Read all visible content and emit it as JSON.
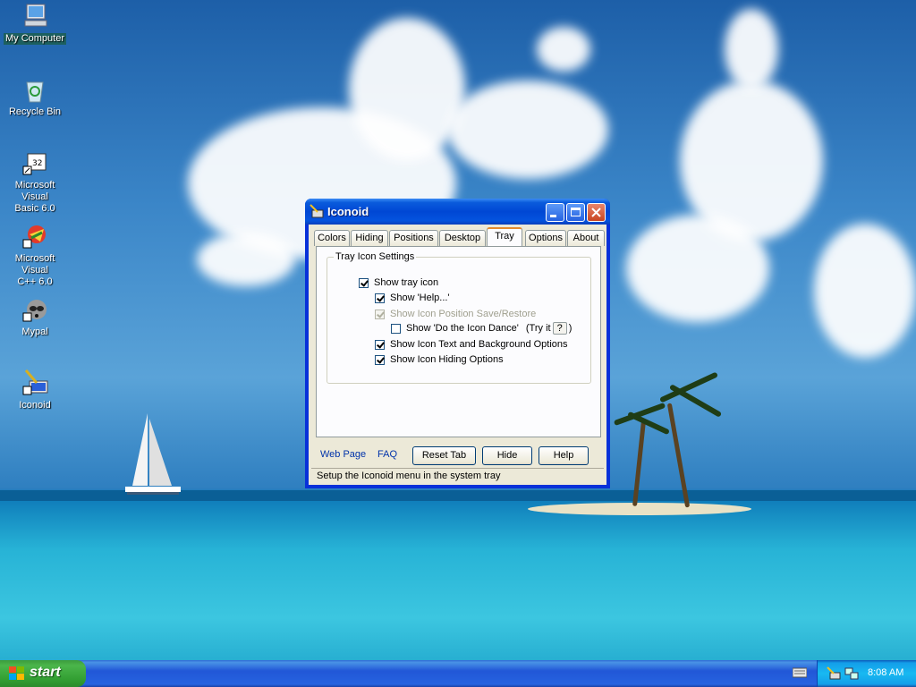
{
  "desktop": {
    "icons": [
      {
        "label": "My Computer",
        "icon": "computer-icon"
      },
      {
        "label": "Recycle Bin",
        "icon": "recycle-bin-icon"
      },
      {
        "label_line1": "Microsoft Visual",
        "label_line2": "Basic 6.0",
        "icon": "visual-basic-icon"
      },
      {
        "label_line1": "Microsoft Visual",
        "label_line2": "C++ 6.0",
        "icon": "visual-cpp-icon"
      },
      {
        "label": "Mypal",
        "icon": "mypal-icon"
      },
      {
        "label": "Iconoid",
        "icon": "iconoid-icon"
      }
    ]
  },
  "window": {
    "title": "Iconoid",
    "tabs": [
      "Colors",
      "Hiding",
      "Positions",
      "Desktop",
      "Tray",
      "Options",
      "About"
    ],
    "active_tab": "Tray",
    "group_title": "Tray  Icon Settings",
    "options": [
      {
        "label": "Show tray icon",
        "checked": true,
        "disabled": false
      },
      {
        "label": "Show 'Help...'",
        "checked": true,
        "disabled": false
      },
      {
        "label": "Show Icon Position Save/Restore",
        "checked": true,
        "disabled": true
      },
      {
        "label": "Show 'Do the Icon Dance'",
        "checked": false,
        "disabled": false
      },
      {
        "label": "Show Icon Text and Background Options",
        "checked": true,
        "disabled": false
      },
      {
        "label": "Show Icon Hiding Options",
        "checked": true,
        "disabled": false
      }
    ],
    "try_it_prefix": "(Try it",
    "try_it_button": "?",
    "try_it_suffix": ")",
    "links": {
      "web_page": "Web Page",
      "faq": "FAQ"
    },
    "buttons": {
      "reset_tab": "Reset Tab",
      "hide": "Hide",
      "help": "Help"
    },
    "status": "Setup the Iconoid menu in the system tray"
  },
  "taskbar": {
    "start_label": "start",
    "clock": "8:08 AM"
  },
  "colors": {
    "title_blue": "#0831d9",
    "start_green": "#3c9c3c",
    "tab_accent": "#e68b2c"
  }
}
